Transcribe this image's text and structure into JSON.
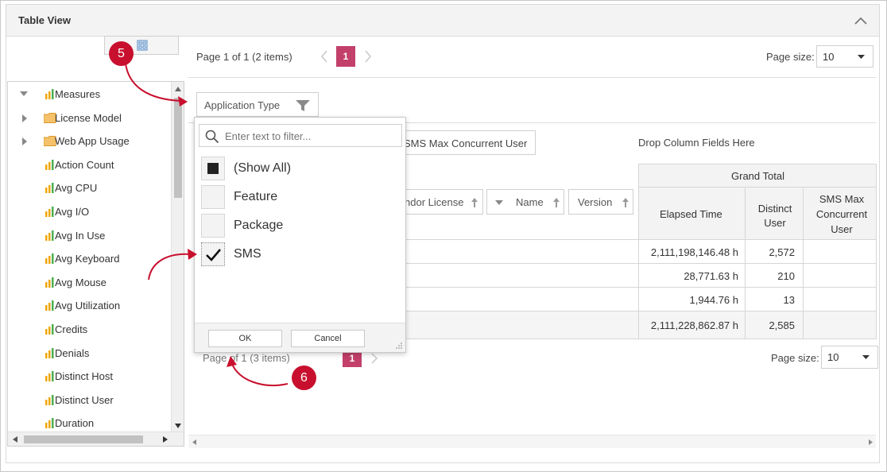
{
  "panel": {
    "title": "Table View"
  },
  "field_list": {
    "items": [
      {
        "label": "Measures",
        "kind": "root"
      },
      {
        "label": "License Model",
        "kind": "folder"
      },
      {
        "label": "Web App Usage",
        "kind": "folder"
      },
      {
        "label": "Action Count",
        "kind": "measure"
      },
      {
        "label": "Avg CPU",
        "kind": "measure"
      },
      {
        "label": "Avg I/O",
        "kind": "measure"
      },
      {
        "label": "Avg In Use",
        "kind": "measure"
      },
      {
        "label": "Avg Keyboard",
        "kind": "measure"
      },
      {
        "label": "Avg Mouse",
        "kind": "measure"
      },
      {
        "label": "Avg Utilization",
        "kind": "measure"
      },
      {
        "label": "Credits",
        "kind": "measure"
      },
      {
        "label": "Denials",
        "kind": "measure"
      },
      {
        "label": "Distinct Host",
        "kind": "measure"
      },
      {
        "label": "Distinct User",
        "kind": "measure"
      },
      {
        "label": "Duration",
        "kind": "measure"
      }
    ]
  },
  "top_pager": {
    "summary": "Page 1 of 1 (2 items)",
    "current_page": "1",
    "page_size_label": "Page size:",
    "page_size": "10"
  },
  "filter_field": {
    "label": "Application Type"
  },
  "data_field": {
    "label": "SMS Max Concurrent User"
  },
  "drop_columns": "Drop Column Fields Here",
  "row_fields": [
    {
      "label": "ndor License"
    },
    {
      "label": "Name"
    },
    {
      "label": "Version"
    }
  ],
  "grid": {
    "grand_total": "Grand Total",
    "columns": [
      "Elapsed Time",
      "Distinct User",
      "SMS Max Concurrent User"
    ],
    "rows": [
      {
        "elapsed": "2,111,198,146.48 h",
        "distinct": "2,572",
        "sms": ""
      },
      {
        "elapsed": "28,771.63 h",
        "distinct": "210",
        "sms": ""
      },
      {
        "elapsed": "1,944.76 h",
        "distinct": "13",
        "sms": ""
      }
    ],
    "total": {
      "elapsed": "2,111,228,862.87 h",
      "distinct": "2,585",
      "sms": ""
    }
  },
  "bottom_pager": {
    "summary": "Page 1 of 1 (3 items)",
    "visible_summary": "Page   of 1 (3 items)",
    "current_page": "1",
    "page_size_label": "Page size:",
    "page_size": "10"
  },
  "filter_popup": {
    "search_placeholder": "Enter text to filter...",
    "options": [
      {
        "label": "(Show All)",
        "state": "indeterminate"
      },
      {
        "label": "Feature",
        "state": "unchecked"
      },
      {
        "label": "Package",
        "state": "unchecked"
      },
      {
        "label": "SMS",
        "state": "checked"
      }
    ],
    "ok_label": "OK",
    "cancel_label": "Cancel"
  },
  "callouts": [
    "5",
    "6"
  ],
  "colors": {
    "accent": "#c2406a",
    "callout": "#c8102e",
    "measure_icon": "#f0a500",
    "folder_icon": "#f5c26b"
  }
}
